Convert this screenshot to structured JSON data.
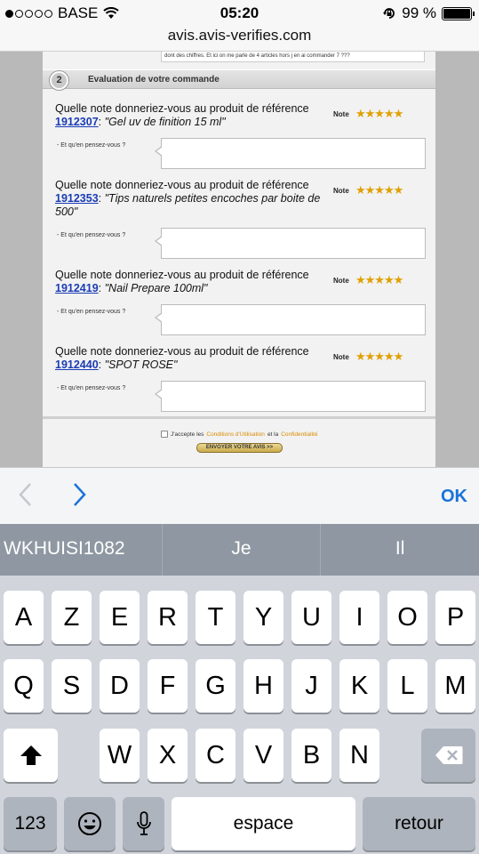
{
  "status_bar": {
    "carrier": "BASE",
    "time": "05:20",
    "battery": "99 %",
    "battery_level": 0.99,
    "signal_bars_filled": 1,
    "signal_bars_total": 5
  },
  "url_bar": {
    "domain": "avis.avis-verifies.com"
  },
  "page": {
    "prev_text": "dont des chiffres. Et ici on me parle de 4 articles hors j en ai commander 7 ???",
    "section": {
      "number": "2",
      "title": "Evaluation de votre commande"
    },
    "products": [
      {
        "question": "Quelle note donneriez-vous au produit de référence",
        "ref": "1912307",
        "sep": ": ",
        "name": "\"Gel uv de finition 15 ml\"",
        "note_label": "Note",
        "rating": 5,
        "stars": "★★★★★",
        "comment_label": "- Et qu'en pensez-vous ?"
      },
      {
        "question": "Quelle note donneriez-vous au produit de référence",
        "ref": "1912353",
        "sep": ": ",
        "name": "\"Tips naturels petites encoches par boite de 500\"",
        "note_label": "Note",
        "rating": 5,
        "stars": "★★★★★",
        "comment_label": "- Et qu'en pensez-vous ?"
      },
      {
        "question": "Quelle note donneriez-vous au produit de référence",
        "ref": "1912419",
        "sep": ": ",
        "name": "\"Nail Prepare 100ml\"",
        "note_label": "Note",
        "rating": 5,
        "stars": "★★★★★",
        "comment_label": "- Et qu'en pensez-vous ?"
      },
      {
        "question": "Quelle note donneriez-vous au produit de référence",
        "ref": "1912440",
        "sep": ": ",
        "name": "\"SPOT ROSE\"",
        "note_label": "Note",
        "rating": 5,
        "stars": "★★★★★",
        "comment_label": "- Et qu'en pensez-vous ?"
      }
    ],
    "accept": {
      "prefix": "J'accepte les",
      "cgu": "Conditions d'Utilisation",
      "and": "et la",
      "privacy": "Confidentialité"
    },
    "submit_label": "ENVOYER VOTRE AVIS >>"
  },
  "accessory": {
    "prev_icon": "chevron-left-icon",
    "next_icon": "chevron-right-icon",
    "ok": "OK"
  },
  "suggestions": [
    "WKHUISI1082",
    "Je",
    "Il"
  ],
  "keyboard": {
    "row1": [
      "A",
      "Z",
      "E",
      "R",
      "T",
      "Y",
      "U",
      "I",
      "O",
      "P"
    ],
    "row2": [
      "Q",
      "S",
      "D",
      "F",
      "G",
      "H",
      "J",
      "K",
      "L",
      "M"
    ],
    "row3": [
      "W",
      "X",
      "C",
      "V",
      "B",
      "N"
    ],
    "numbers_label": "123",
    "space_label": "espace",
    "return_label": "retour",
    "shift_icon": "shift-icon",
    "delete_icon": "delete-icon",
    "emoji_icon": "emoji-icon",
    "mic_icon": "microphone-icon"
  },
  "colors": {
    "link": "#1a3cb5",
    "star": "#e0a000",
    "ios_blue": "#1a73d9",
    "suggestion_bg": "#8f98a2",
    "keyboard_bg": "#d1d5db"
  }
}
